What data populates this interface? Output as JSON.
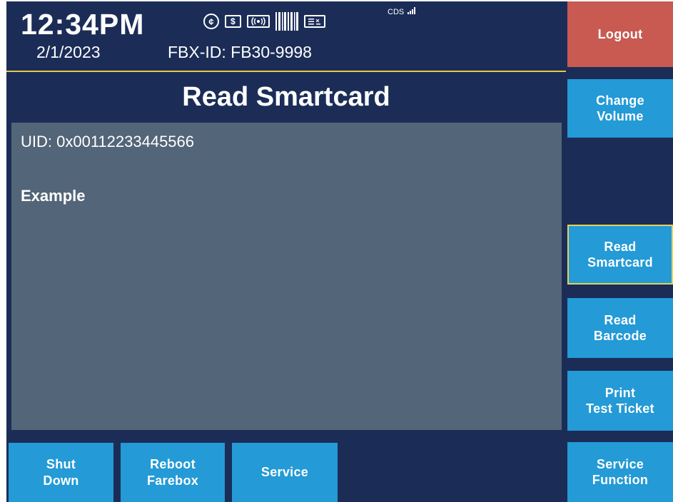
{
  "header": {
    "time": "12:34PM",
    "date": "2/1/2023",
    "fbx_id": "FBX-ID: FB30-9998",
    "network_label": "CDS",
    "status_icons": [
      {
        "icon": "coin-icon",
        "glyph": "¢"
      },
      {
        "icon": "bill-icon",
        "glyph": "$"
      },
      {
        "icon": "contactless-icon",
        "glyph": "((•))"
      },
      {
        "icon": "barcode-icon",
        "glyph": "||||"
      },
      {
        "icon": "card-reader-icon",
        "glyph": "≡"
      }
    ]
  },
  "screen": {
    "title": "Read Smartcard",
    "uid_line": "UID: 0x00112233445566",
    "detail_line": "Example"
  },
  "sidebar": {
    "logout": "Logout",
    "change_volume": [
      "Change",
      "Volume"
    ],
    "read_smartcard": [
      "Read",
      "Smartcard"
    ],
    "read_barcode": [
      "Read",
      "Barcode"
    ],
    "print_test_ticket": [
      "Print",
      "Test Ticket"
    ],
    "service_function": [
      "Service",
      "Function"
    ]
  },
  "bottom": {
    "shut_down": [
      "Shut",
      "Down"
    ],
    "reboot_farebox": [
      "Reboot",
      "Farebox"
    ],
    "service": "Service"
  },
  "colors": {
    "background": "#1b2d57",
    "button": "#249ad6",
    "logout": "#c85a52",
    "content_panel": "#536578",
    "highlight": "#e6c84a"
  }
}
